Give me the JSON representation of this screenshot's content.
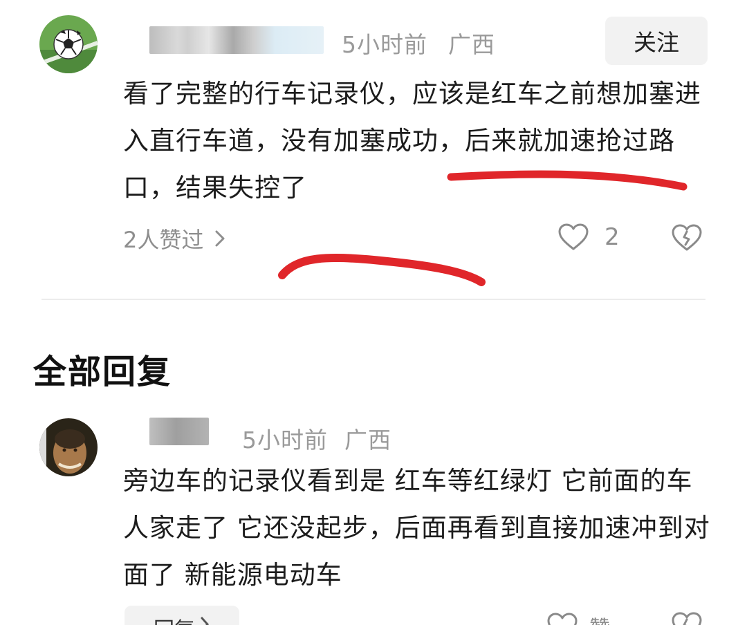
{
  "main_comment": {
    "time": "5小时前",
    "location": "广西",
    "follow_label": "关注",
    "text": "看了完整的行车记录仪，应该是红车之前想加塞进入直行车道，没有加塞成功，后来就加速抢过路口，结果失控了",
    "liked_by": "2人赞过",
    "like_count": "2"
  },
  "section": {
    "title": "全部回复"
  },
  "reply": {
    "time": "5小时前",
    "location": "广西",
    "text": "旁边车的记录仪看到是 红车等红绿灯 它前面的车人家走了 它还没起步，后面再看到直接加速冲到对面了 新能源电动车",
    "reply_label": "回复",
    "like_label": "赞"
  },
  "colors": {
    "marker_red": "#e0262a",
    "muted_text": "#9a9a9a",
    "button_bg": "#f2f2f2"
  },
  "icons": [
    "soccer-ball-avatar",
    "chevron-right-icon",
    "heart-outline-icon",
    "broken-heart-icon"
  ]
}
